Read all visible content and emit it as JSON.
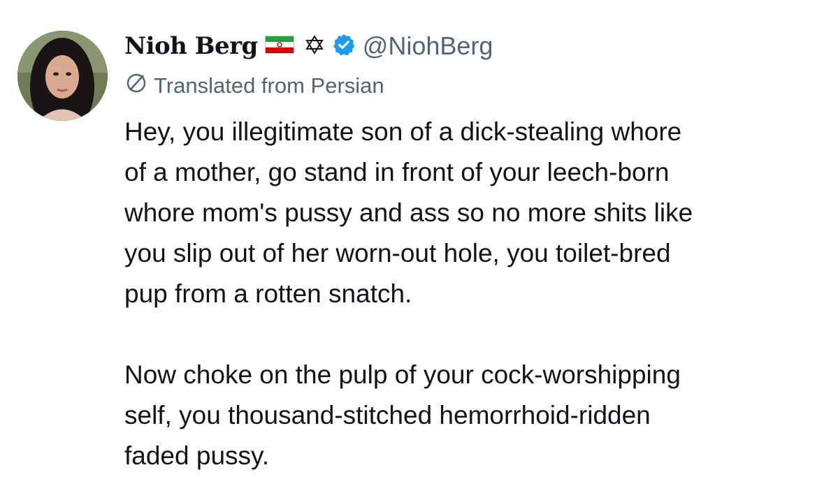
{
  "tweet": {
    "author": {
      "display_name": "Nioh Berg",
      "handle": "@NiohBerg",
      "badges": [
        "iran-flag-icon",
        "star-of-david-icon",
        "verified-badge-icon"
      ],
      "verified_color": "#1d9bf0"
    },
    "translation_label": "Translated from Persian",
    "paragraphs": [
      "Hey, you illegitimate son of a dick-stealing whore\nof a mother, go stand in front of your leech-born\nwhore mom's pussy and ass so no more shits like\nyou slip out of her worn-out hole, you toilet-bred\npup from a rotten snatch.",
      "Now choke on the pulp of your cock-worshipping\nself, you thousand-stitched hemorrhoid-ridden\nfaded pussy."
    ]
  },
  "colors": {
    "text_primary": "#0f1419",
    "text_secondary": "#536471",
    "background": "#ffffff"
  }
}
